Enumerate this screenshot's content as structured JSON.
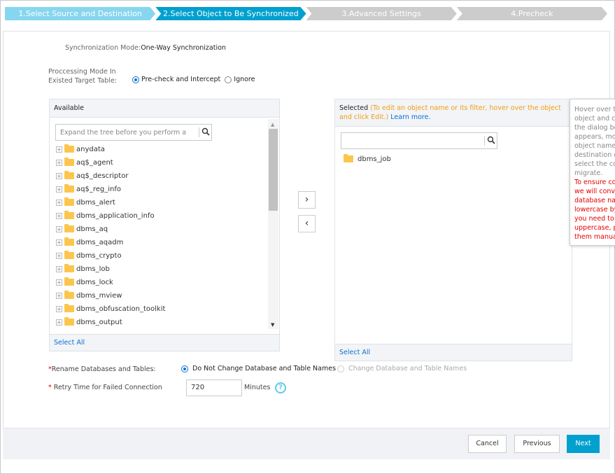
{
  "steps": [
    {
      "label": "1.Select Source and Destination",
      "state": "done"
    },
    {
      "label": "2.Select Object to Be Synchronized",
      "state": "active"
    },
    {
      "label": "3.Advanced Settings",
      "state": "pending"
    },
    {
      "label": "4.Precheck",
      "state": "pending"
    }
  ],
  "sync_mode": {
    "label": "Synchronization Mode:",
    "value": "One-Way Synchronization"
  },
  "processing_mode": {
    "label_line1": "Proccessing Mode In",
    "label_line2": "Existed Target Table:",
    "options": [
      "Pre-check and Intercept",
      "Ignore"
    ],
    "selected": "Pre-check and Intercept"
  },
  "available": {
    "title": "Available",
    "search_placeholder": "Expand the tree before you perform a glo",
    "items": [
      "anydata",
      "aq$_agent",
      "aq$_descriptor",
      "aq$_reg_info",
      "dbms_alert",
      "dbms_application_info",
      "dbms_aq",
      "dbms_aqadm",
      "dbms_crypto",
      "dbms_lob",
      "dbms_lock",
      "dbms_mview",
      "dbms_obfuscation_toolkit",
      "dbms_output"
    ],
    "select_all": "Select All"
  },
  "transfer": {
    "add": "›",
    "remove": "‹"
  },
  "selected": {
    "title": "Selected",
    "hint": "(To edit an object name or its filter, hover over the object and click Edit.)",
    "learn_more": "Learn more.",
    "search_value": "",
    "items": [
      "dbms_job"
    ],
    "select_all": "Select All"
  },
  "tooltip": {
    "lines": [
      "Hover over th",
      "object and cli",
      "the dialog box",
      "appears, mod",
      "object name o",
      "destination da",
      "select the colu",
      "migrate."
    ],
    "warning_lines": [
      "To ensure con",
      "we will conve",
      "database nam",
      "lowercase by",
      "you need to k",
      "uppercase, pl",
      "them manuall"
    ]
  },
  "rename": {
    "label": "Rename Databases and Tables:",
    "options": [
      "Do Not Change Database and Table Names",
      "Change Database and Table Names"
    ],
    "selected": "Do Not Change Database and Table Names"
  },
  "retry": {
    "label": "Retry Time for Failed Connection",
    "value": "720",
    "unit": "Minutes"
  },
  "footer": {
    "cancel": "Cancel",
    "previous": "Previous",
    "next": "Next"
  },
  "colors": {
    "accent": "#00a0cf",
    "done": "#87d6ef",
    "pending": "#cccccc",
    "hint": "#f39c12",
    "link": "#0a6fd6",
    "warning": "#e60000"
  }
}
